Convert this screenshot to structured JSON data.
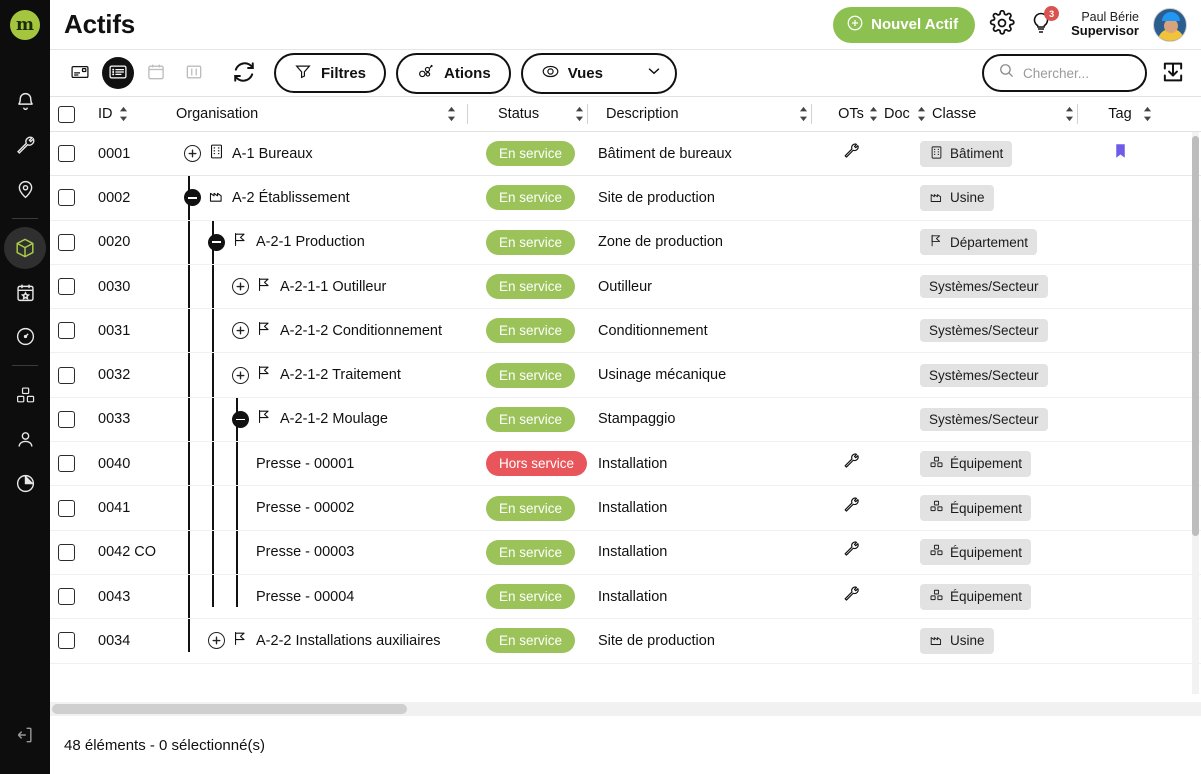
{
  "app": {
    "logo_letter": "m",
    "title": "Actifs"
  },
  "sidebar": {
    "items": [
      {
        "name": "notifications",
        "icon": "bell-icon",
        "active": false
      },
      {
        "name": "maintenance",
        "icon": "wrench-icon",
        "active": false
      },
      {
        "name": "locations",
        "icon": "map-pin-icon",
        "active": false
      },
      {
        "name": "assets",
        "icon": "cube-icon",
        "active": true
      },
      {
        "name": "planning",
        "icon": "calendar-star-icon",
        "active": false
      },
      {
        "name": "dashboard",
        "icon": "gauge-icon",
        "active": false
      },
      {
        "name": "inventory",
        "icon": "boxes-icon",
        "active": false
      },
      {
        "name": "users",
        "icon": "person-icon",
        "active": false
      },
      {
        "name": "reports",
        "icon": "pie-chart-icon",
        "active": false
      }
    ],
    "logout_icon": "logout-arrow-icon"
  },
  "header": {
    "title": "Actifs",
    "new_asset_label": "Nouvel Actif",
    "settings_icon": "gear-icon",
    "tips_icon": "lightbulb-icon",
    "tips_badge": "3",
    "user_name": "Paul Bérie",
    "user_role": "Supervisor"
  },
  "toolbar": {
    "views": [
      {
        "name": "card-view",
        "icon": "card-view-icon",
        "active": false,
        "disabled": false
      },
      {
        "name": "list-view",
        "icon": "list-view-icon",
        "active": true,
        "disabled": false
      },
      {
        "name": "calendar-view",
        "icon": "calendar-view-icon",
        "active": false,
        "disabled": true
      },
      {
        "name": "kanban-view",
        "icon": "kanban-view-icon",
        "active": false,
        "disabled": true
      }
    ],
    "refresh_icon": "refresh-icon",
    "filters_label": "Filtres",
    "actions_label": "Ations",
    "views_label": "Vues",
    "download_icon": "download-icon"
  },
  "search": {
    "placeholder": "Chercher...",
    "value": "",
    "icon": "search-icon"
  },
  "table": {
    "columns": [
      {
        "key": "id",
        "label": "ID",
        "sortable": true
      },
      {
        "key": "organisation",
        "label": "Organisation",
        "sortable": true
      },
      {
        "key": "status",
        "label": "Status",
        "sortable": true
      },
      {
        "key": "description",
        "label": "Description",
        "sortable": true
      },
      {
        "key": "ots",
        "label": "OTs",
        "sortable": true
      },
      {
        "key": "doc",
        "label": "Doc",
        "sortable": true
      },
      {
        "key": "classe",
        "label": "Classe",
        "sortable": true
      },
      {
        "key": "tag",
        "label": "Tag",
        "sortable": true
      }
    ],
    "rows": [
      {
        "id": "0001",
        "level": 0,
        "toggle": "plus",
        "node_icon": "building-icon",
        "organisation": "A-1 Bureaux",
        "status": "En service",
        "status_type": "ok",
        "description": "Bâtiment de bureaux",
        "ots_icon": "wrench-icon",
        "doc": "",
        "classe": "Bâtiment",
        "classe_icon": "building-icon",
        "tag_icon": "bookmark-icon"
      },
      {
        "id": "0002",
        "level": 0,
        "toggle": "minus",
        "node_icon": "factory-icon",
        "organisation": "A-2 Établissement",
        "status": "En service",
        "status_type": "ok",
        "description": "Site de production",
        "ots_icon": "",
        "doc": "",
        "classe": "Usine",
        "classe_icon": "factory-icon",
        "tag_icon": ""
      },
      {
        "id": "0020",
        "level": 1,
        "toggle": "minus",
        "node_icon": "flag-icon",
        "organisation": "A-2-1 Production",
        "status": "En service",
        "status_type": "ok",
        "description": "Zone de production",
        "ots_icon": "",
        "doc": "",
        "classe": "Département",
        "classe_icon": "flag-icon",
        "tag_icon": ""
      },
      {
        "id": "0030",
        "level": 2,
        "toggle": "plus",
        "node_icon": "flag-icon",
        "organisation": "A-2-1-1 Outilleur",
        "status": "En service",
        "status_type": "ok",
        "description": "Outilleur",
        "ots_icon": "",
        "doc": "",
        "classe": "Systèmes/Secteur",
        "classe_icon": "",
        "tag_icon": ""
      },
      {
        "id": "0031",
        "level": 2,
        "toggle": "plus",
        "node_icon": "flag-icon",
        "organisation": "A-2-1-2 Conditionnement",
        "status": "En service",
        "status_type": "ok",
        "description": "Conditionnement",
        "ots_icon": "",
        "doc": "",
        "classe": "Systèmes/Secteur",
        "classe_icon": "",
        "tag_icon": ""
      },
      {
        "id": "0032",
        "level": 2,
        "toggle": "plus",
        "node_icon": "flag-icon",
        "organisation": "A-2-1-2 Traitement",
        "status": "En service",
        "status_type": "ok",
        "description": "Usinage mécanique",
        "ots_icon": "",
        "doc": "",
        "classe": "Systèmes/Secteur",
        "classe_icon": "",
        "tag_icon": ""
      },
      {
        "id": "0033",
        "level": 2,
        "toggle": "minus",
        "node_icon": "flag-icon",
        "organisation": "A-2-1-2 Moulage",
        "status": "En service",
        "status_type": "ok",
        "description": "Stampaggio",
        "ots_icon": "",
        "doc": "",
        "classe": "Systèmes/Secteur",
        "classe_icon": "",
        "tag_icon": ""
      },
      {
        "id": "0040",
        "level": 3,
        "toggle": "",
        "node_icon": "",
        "organisation": "Presse - 00001",
        "status": "Hors service",
        "status_type": "ko",
        "description": "Installation",
        "ots_icon": "wrench-icon",
        "doc": "",
        "classe": "Équipement",
        "classe_icon": "boxes-icon",
        "tag_icon": ""
      },
      {
        "id": "0041",
        "level": 3,
        "toggle": "",
        "node_icon": "",
        "organisation": "Presse - 00002",
        "status": "En service",
        "status_type": "ok",
        "description": "Installation",
        "ots_icon": "wrench-icon",
        "doc": "",
        "classe": "Équipement",
        "classe_icon": "boxes-icon",
        "tag_icon": ""
      },
      {
        "id": "0042 CO",
        "level": 3,
        "toggle": "",
        "node_icon": "",
        "organisation": "Presse - 00003",
        "status": "En service",
        "status_type": "ok",
        "description": "Installation",
        "ots_icon": "wrench-icon",
        "doc": "",
        "classe": "Équipement",
        "classe_icon": "boxes-icon",
        "tag_icon": ""
      },
      {
        "id": "0043",
        "level": 3,
        "toggle": "",
        "node_icon": "",
        "organisation": "Presse - 00004",
        "status": "En service",
        "status_type": "ok",
        "description": "Installation",
        "ots_icon": "wrench-icon",
        "doc": "",
        "classe": "Équipement",
        "classe_icon": "boxes-icon",
        "tag_icon": ""
      },
      {
        "id": "0034",
        "level": 1,
        "toggle": "plus",
        "node_icon": "flag-icon",
        "organisation": "A-2-2 Installations auxiliaires",
        "status": "En service",
        "status_type": "ok",
        "description": "Site de production",
        "ots_icon": "",
        "doc": "",
        "classe": "Usine",
        "classe_icon": "factory-icon",
        "tag_icon": ""
      }
    ]
  },
  "footer": {
    "status_text": "48 éléments - 0 sélectionné(s)"
  },
  "colors": {
    "accent_green": "#8cc152",
    "status_ok": "#9bc35a",
    "status_ko": "#e8565b",
    "sidebar_bg": "#0d0d0d",
    "tag_purple": "#6c5ce7"
  }
}
